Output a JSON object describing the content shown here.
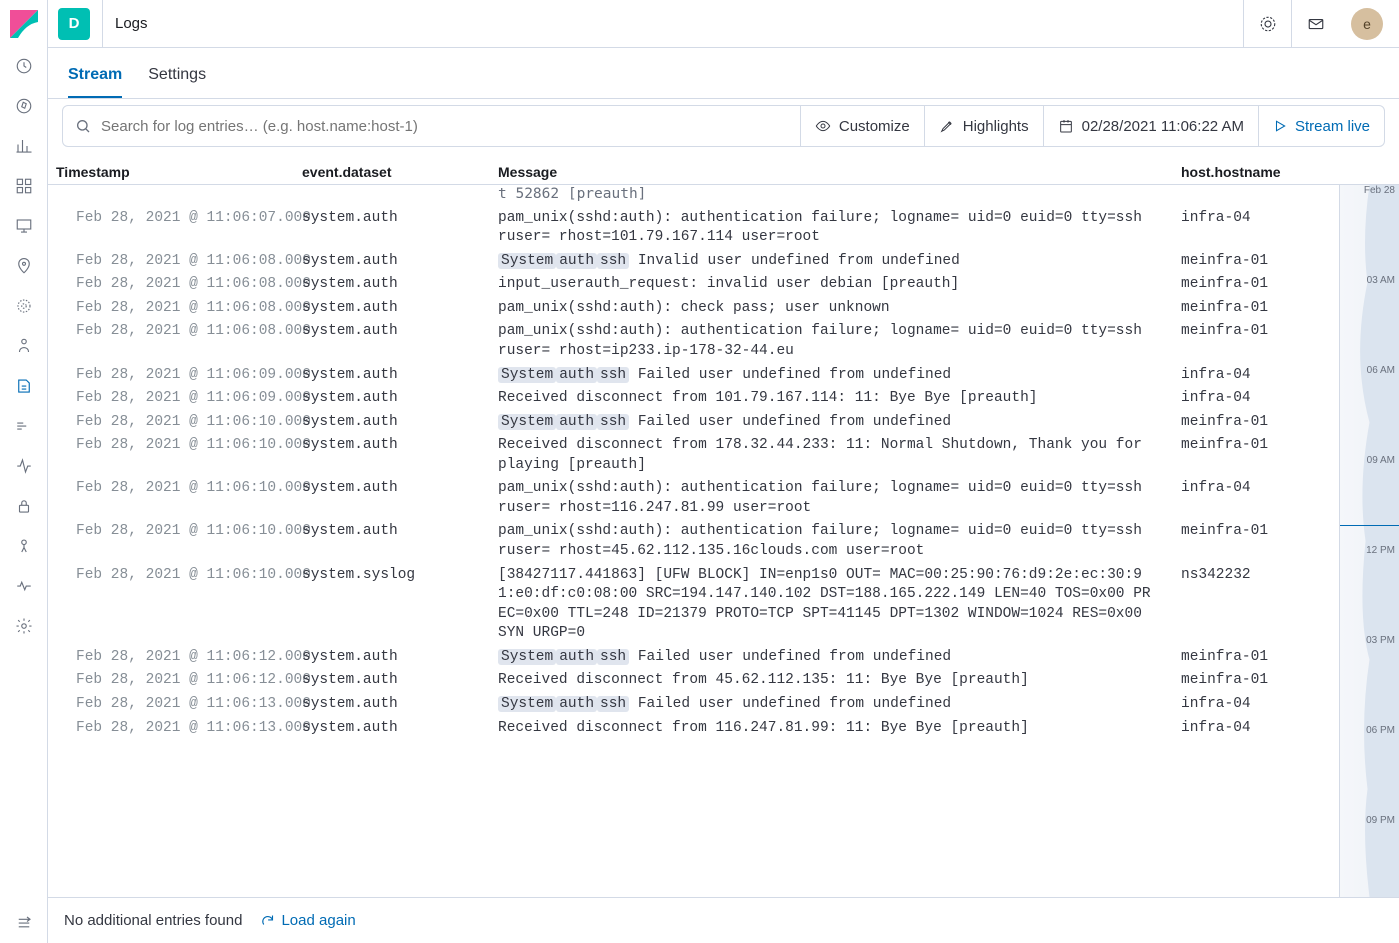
{
  "topbar": {
    "space_letter": "D",
    "title": "Logs",
    "avatar_letter": "e"
  },
  "tabs": {
    "stream": "Stream",
    "settings": "Settings"
  },
  "toolbar": {
    "search_placeholder": "Search for log entries… (e.g. host.name:host-1)",
    "customize": "Customize",
    "highlights": "Highlights",
    "datetime": "02/28/2021 11:06:22 AM",
    "stream_live": "Stream live"
  },
  "headers": {
    "timestamp": "Timestamp",
    "dataset": "event.dataset",
    "message": "Message",
    "host": "host.hostname"
  },
  "partial_top": "t 52862 [preauth]",
  "rows": [
    {
      "ts": "Feb 28, 2021 @ 11:06:07.000",
      "ds": "system.auth",
      "msg": "pam_unix(sshd:auth): authentication failure; logname= uid=0 euid=0 tty=ssh ruser= rhost=101.79.167.114  user=root",
      "host": "infra-04"
    },
    {
      "ts": "Feb 28, 2021 @ 11:06:08.000",
      "ds": "system.auth",
      "msg": "[System][auth][ssh] Invalid user undefined from undefined",
      "host": "meinfra-01",
      "pills": true,
      "evt": "Invalid"
    },
    {
      "ts": "Feb 28, 2021 @ 11:06:08.000",
      "ds": "system.auth",
      "msg": "input_userauth_request: invalid user debian [preauth]",
      "host": "meinfra-01"
    },
    {
      "ts": "Feb 28, 2021 @ 11:06:08.000",
      "ds": "system.auth",
      "msg": "pam_unix(sshd:auth): check pass; user unknown",
      "host": "meinfra-01"
    },
    {
      "ts": "Feb 28, 2021 @ 11:06:08.000",
      "ds": "system.auth",
      "msg": "pam_unix(sshd:auth): authentication failure; logname= uid=0 euid=0 tty=ssh ruser= rhost=ip233.ip-178-32-44.eu",
      "host": "meinfra-01"
    },
    {
      "ts": "Feb 28, 2021 @ 11:06:09.000",
      "ds": "system.auth",
      "msg": "[System][auth][ssh] Failed user undefined from undefined",
      "host": "infra-04",
      "pills": true,
      "evt": "Failed"
    },
    {
      "ts": "Feb 28, 2021 @ 11:06:09.000",
      "ds": "system.auth",
      "msg": "Received disconnect from 101.79.167.114: 11: Bye Bye [preauth]",
      "host": "infra-04"
    },
    {
      "ts": "Feb 28, 2021 @ 11:06:10.000",
      "ds": "system.auth",
      "msg": "[System][auth][ssh] Failed user undefined from undefined",
      "host": "meinfra-01",
      "pills": true,
      "evt": "Failed"
    },
    {
      "ts": "Feb 28, 2021 @ 11:06:10.000",
      "ds": "system.auth",
      "msg": "Received disconnect from 178.32.44.233: 11: Normal Shutdown, Thank you for playing [preauth]",
      "host": "meinfra-01"
    },
    {
      "ts": "Feb 28, 2021 @ 11:06:10.000",
      "ds": "system.auth",
      "msg": "pam_unix(sshd:auth): authentication failure; logname= uid=0 euid=0 tty=ssh ruser= rhost=116.247.81.99  user=root",
      "host": "infra-04"
    },
    {
      "ts": "Feb 28, 2021 @ 11:06:10.000",
      "ds": "system.auth",
      "msg": "pam_unix(sshd:auth): authentication failure; logname= uid=0 euid=0 tty=ssh ruser= rhost=45.62.112.135.16clouds.com  user=root",
      "host": "meinfra-01"
    },
    {
      "ts": "Feb 28, 2021 @ 11:06:10.000",
      "ds": "system.syslog",
      "msg": "[38427117.441863] [UFW BLOCK] IN=enp1s0 OUT= MAC=00:25:90:76:d9:2e:ec:30:91:e0:df:c0:08:00 SRC=194.147.140.102 DST=188.165.222.149 LEN=40 TOS=0x00 PREC=0x00 TTL=248 ID=21379 PROTO=TCP SPT=41145 DPT=1302 WINDOW=1024 RES=0x00 SYN URGP=0",
      "host": "ns342232"
    },
    {
      "ts": "Feb 28, 2021 @ 11:06:12.000",
      "ds": "system.auth",
      "msg": "[System][auth][ssh] Failed user undefined from undefined",
      "host": "meinfra-01",
      "pills": true,
      "evt": "Failed"
    },
    {
      "ts": "Feb 28, 2021 @ 11:06:12.000",
      "ds": "system.auth",
      "msg": "Received disconnect from 45.62.112.135: 11: Bye Bye [preauth]",
      "host": "meinfra-01"
    },
    {
      "ts": "Feb 28, 2021 @ 11:06:13.000",
      "ds": "system.auth",
      "msg": "[System][auth][ssh] Failed user undefined from undefined",
      "host": "infra-04",
      "pills": true,
      "evt": "Failed"
    },
    {
      "ts": "Feb 28, 2021 @ 11:06:13.000",
      "ds": "system.auth",
      "msg": "Received disconnect from 116.247.81.99: 11: Bye Bye [preauth]",
      "host": "infra-04"
    }
  ],
  "minimap": {
    "topdate": "Feb 28",
    "ticks": [
      "03 AM",
      "06 AM",
      "09 AM",
      "12 PM",
      "03 PM",
      "06 PM",
      "09 PM"
    ]
  },
  "footer": {
    "no_more": "No additional entries found",
    "load_again": "Load again"
  }
}
